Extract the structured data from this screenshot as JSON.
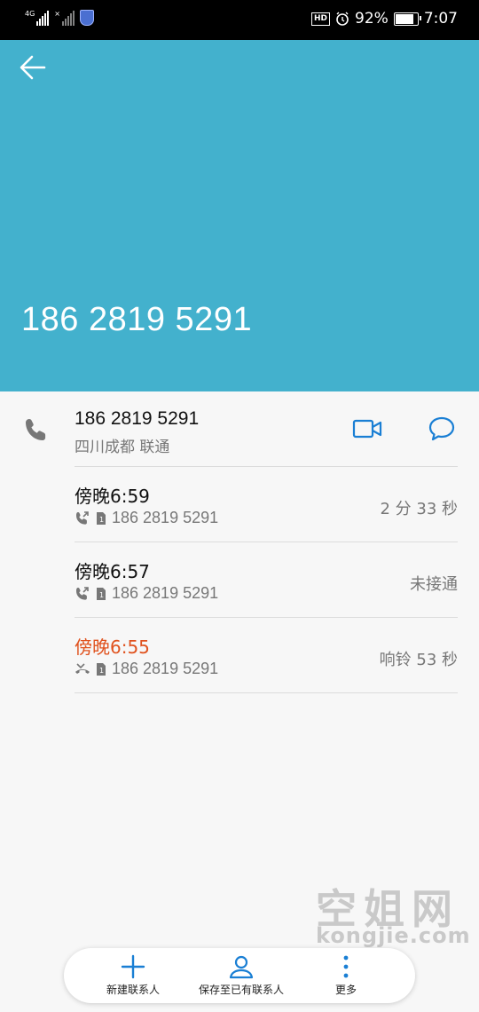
{
  "status_bar": {
    "network_label": "4G",
    "battery_percent": "92%",
    "battery_level": 0.92,
    "time": "7:07",
    "hd_label": "HD"
  },
  "header": {
    "back_icon": "arrow-left-icon",
    "number": "186 2819 5291",
    "color": "#43b1cd"
  },
  "contact": {
    "number": "186 2819 5291",
    "location": "四川成都 联通"
  },
  "calls": [
    {
      "time": "傍晚6:59",
      "number": "186 2819 5291",
      "duration": "2 分 33 秒",
      "type": "outgoing"
    },
    {
      "time": "傍晚6:57",
      "number": "186 2819 5291",
      "duration": "未接通",
      "type": "outgoing"
    },
    {
      "time": "傍晚6:55",
      "number": "186 2819 5291",
      "duration": "响铃 53 秒",
      "type": "missed"
    }
  ],
  "colors": {
    "accent": "#1a7fd4",
    "missed": "#e0531f"
  },
  "watermark": {
    "title": "空姐网",
    "url": "kongjie.com"
  },
  "bottom_bar": {
    "new_contact": "新建联系人",
    "save_existing": "保存至已有联系人",
    "more": "更多"
  }
}
